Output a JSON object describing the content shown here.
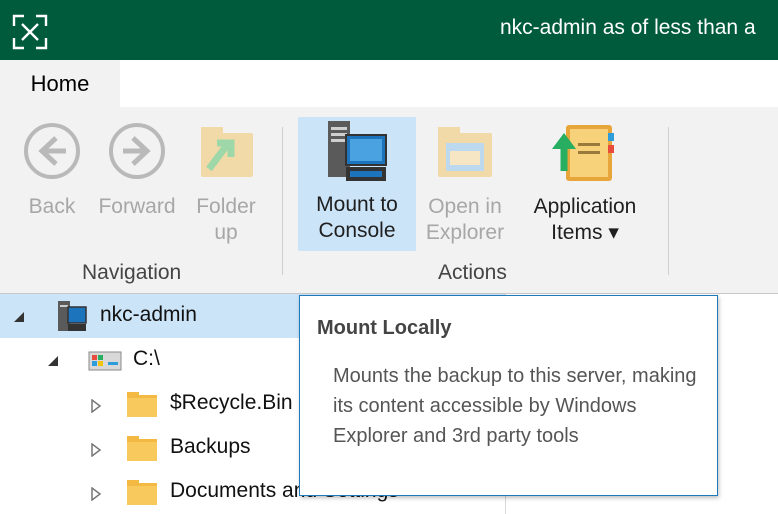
{
  "titlebar": {
    "title": "nkc-admin as of less than a"
  },
  "tabs": [
    {
      "label": "Home"
    }
  ],
  "ribbon": {
    "navigation": {
      "label": "Navigation",
      "buttons": [
        {
          "label1": "Back",
          "label2": ""
        },
        {
          "label1": "Forward",
          "label2": ""
        },
        {
          "label1": "Folder",
          "label2": "up"
        }
      ]
    },
    "actions": {
      "label": "Actions",
      "buttons": [
        {
          "label1": "Mount to",
          "label2": "Console"
        },
        {
          "label1": "Open in",
          "label2": "Explorer"
        },
        {
          "label1": "Application",
          "label2": "Items ▾"
        }
      ]
    }
  },
  "tree": {
    "items": [
      {
        "label": "nkc-admin"
      },
      {
        "label": "C:\\"
      },
      {
        "label": "$Recycle.Bin"
      },
      {
        "label": "Backups"
      },
      {
        "label": "Documents and Settings"
      }
    ]
  },
  "tooltip": {
    "title": "Mount Locally",
    "body": "Mounts the backup to this server, making its content accessible by Windows Explorer and 3rd party tools"
  }
}
